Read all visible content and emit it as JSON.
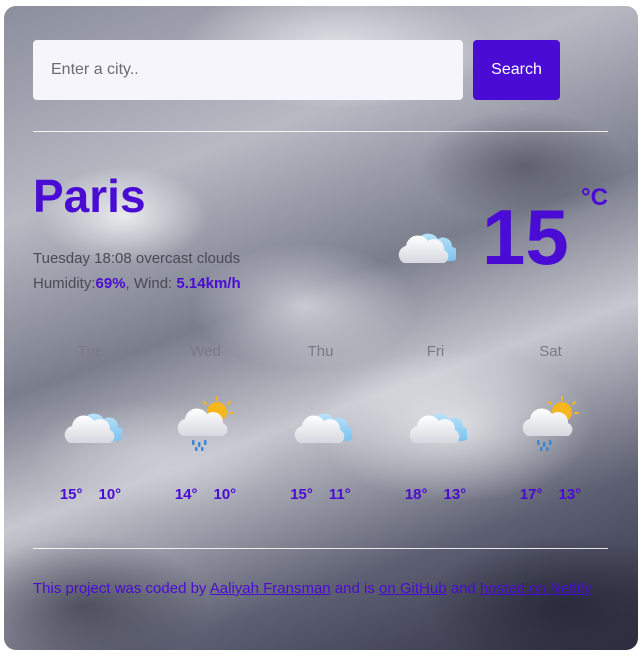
{
  "search": {
    "placeholder": "Enter a city..",
    "button_label": "Search"
  },
  "current": {
    "city": "Paris",
    "day_time": "Tuesday 18:08",
    "description": "overcast clouds",
    "humidity_label": "Humidity:",
    "humidity_value": "69%",
    "wind_label": ", Wind: ",
    "wind_value": "5.14km/h",
    "temperature": "15",
    "unit": "°C",
    "icon": "cloud-icon"
  },
  "forecast": [
    {
      "day": "Tue",
      "max": "15°",
      "min": "10°",
      "icon": "cloud-icon"
    },
    {
      "day": "Wed",
      "max": "14°",
      "min": "10°",
      "icon": "sun-cloud-rain-icon"
    },
    {
      "day": "Thu",
      "max": "15°",
      "min": "11°",
      "icon": "cloud-icon"
    },
    {
      "day": "Fri",
      "max": "18°",
      "min": "13°",
      "icon": "cloud-icon"
    },
    {
      "day": "Sat",
      "max": "17°",
      "min": "13°",
      "icon": "sun-cloud-rain-icon"
    }
  ],
  "footer": {
    "text1": "This project was coded by ",
    "author_link": "Aaliyah Fransman",
    "text2": " and is ",
    "github_link": "on GitHub",
    "text3": " and ",
    "netlify_link": "hosted on Netlify"
  },
  "colors": {
    "accent": "#4a0bd4",
    "input_bg": "#f6f5fb"
  }
}
